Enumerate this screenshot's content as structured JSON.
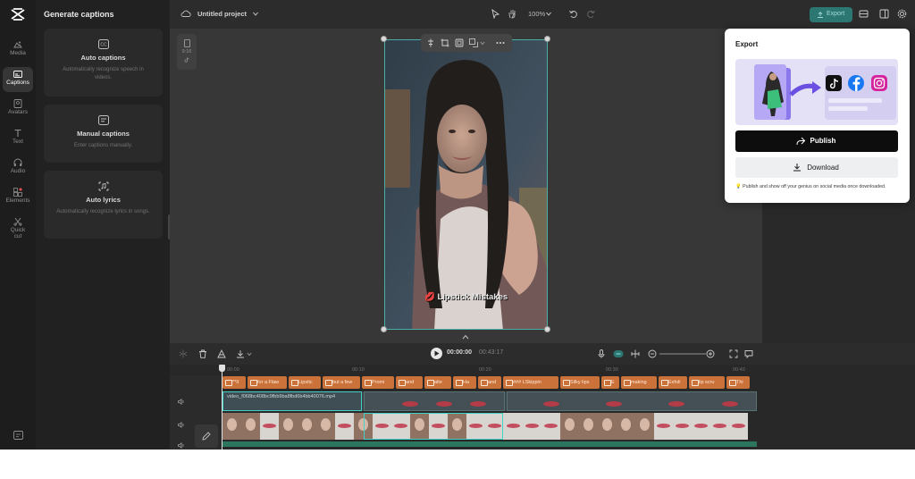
{
  "rail": {
    "items": [
      {
        "label": "Media",
        "icon": "media-icon"
      },
      {
        "label": "Captions",
        "icon": "captions-icon"
      },
      {
        "label": "Avatars",
        "icon": "avatars-icon"
      },
      {
        "label": "Text",
        "icon": "text-icon"
      },
      {
        "label": "Audio",
        "icon": "audio-icon"
      },
      {
        "label": "Elements",
        "icon": "elements-icon"
      },
      {
        "label": "Quick",
        "label2": "cut",
        "icon": "quick-cut-icon"
      }
    ]
  },
  "panel": {
    "title": "Generate captions",
    "cards": [
      {
        "title": "Auto captions",
        "desc": "Automatically recognize speech in videos."
      },
      {
        "title": "Manual captions",
        "desc": "Enter captions manually."
      },
      {
        "title": "Auto lyrics",
        "desc": "Automatically recognize lyrics in songs."
      }
    ]
  },
  "topbar": {
    "project_title": "Untitled project",
    "zoom": "100%",
    "export_label": "Export"
  },
  "canvas": {
    "ratio_label": "9:16",
    "caption_emoji": "💋",
    "caption_text": "Lipstick Mistakes"
  },
  "timeline": {
    "current_time": "00:00:00",
    "duration": "00:43:17",
    "ruler": [
      "00:00",
      "00:10",
      "00:20",
      "00:30",
      "00:40"
    ],
    "caption_chips": [
      "**II",
      "for a Flaw",
      "Lipstic",
      "but a few",
      "Promi",
      "and",
      "alte",
      "Ha",
      "and",
      "### LSkippin",
      "Silky lips",
      "E",
      "making",
      "Exfoli",
      "lip scru",
      "Thi"
    ],
    "video_clip_name": "video_f068bc408bc9fbb9ba8fbd6b4bb40076.mp4"
  },
  "export_popover": {
    "title": "Export",
    "publish_label": "Publish",
    "download_label": "Download",
    "tip": "Publish and show off your genius on social media once downloaded."
  },
  "colors": {
    "accent_teal": "#38d0c4",
    "caption_chip": "#c86a2e",
    "promo_arrow": "#6b4fe0"
  }
}
